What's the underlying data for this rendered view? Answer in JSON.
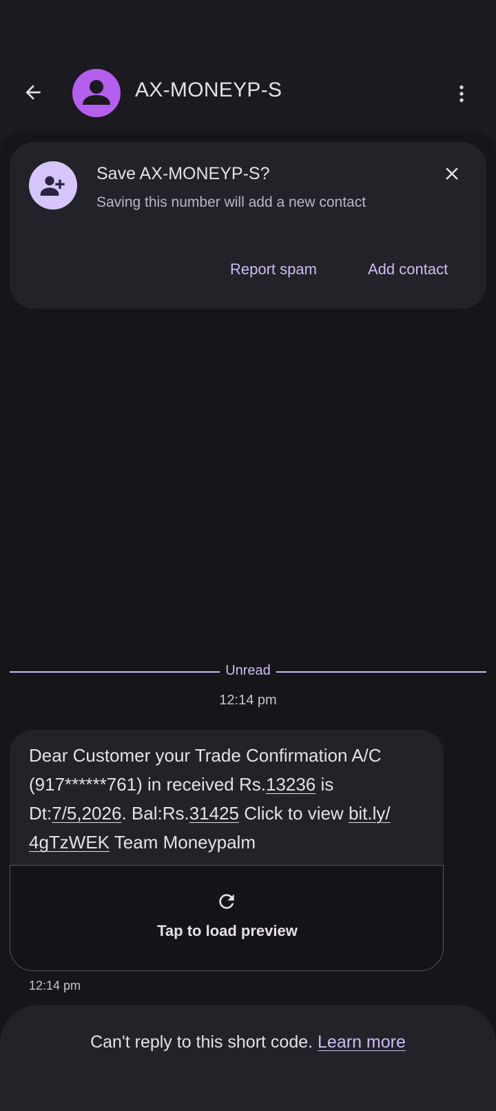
{
  "header": {
    "title": "AX-MONEYP-S",
    "back_icon": "arrow-back-icon",
    "avatar_icon": "person-icon",
    "avatar_color": "#b45ff0",
    "menu_icon": "more-vert-icon"
  },
  "save_card": {
    "title": "Save AX-MONEYP-S?",
    "subtitle": "Saving this number will add a new contact",
    "icon": "person-add-icon",
    "close_icon": "close-icon",
    "actions": {
      "report_spam": "Report spam",
      "add_contact": "Add contact"
    }
  },
  "divider": {
    "label": "Unread"
  },
  "date_stamp": "12:14 pm",
  "message": {
    "parts": [
      "Dear Customer your Trade Confirmation A/C (917******761) in received Rs.",
      "13236",
      " is Dt:",
      "7/5,2026",
      ". Bal:Rs.",
      "31425",
      " Click to view ",
      "bit.ly/ 4gTzWEK",
      " Team Moneypalm"
    ],
    "time": "12:14 pm",
    "preview": {
      "label": "Tap to load preview",
      "icon": "refresh-icon"
    }
  },
  "reply_bar": {
    "text": "Can't reply to this short code. ",
    "link": "Learn more"
  },
  "colors": {
    "background": "#1b1a1f",
    "card": "#232228",
    "accent": "#cdbdf5",
    "text": "#e6e1e9"
  }
}
